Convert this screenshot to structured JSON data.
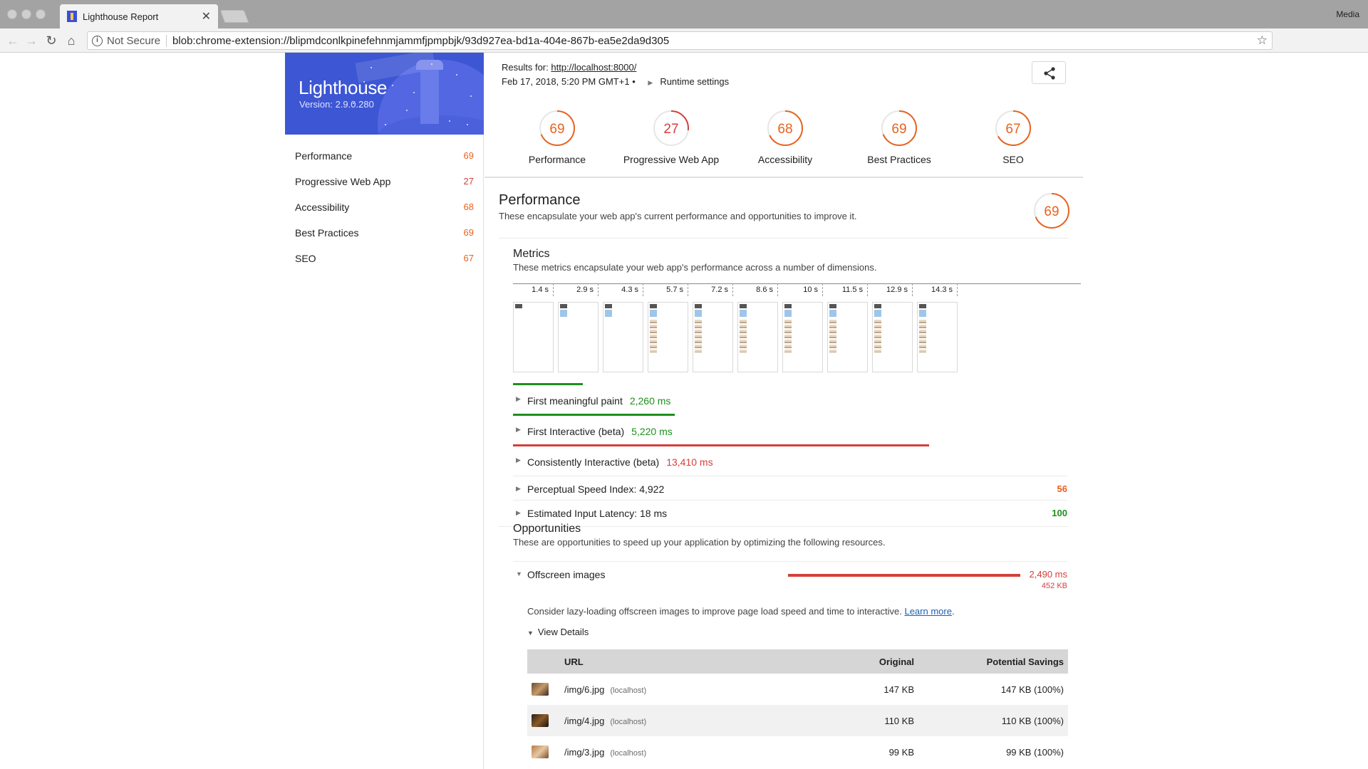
{
  "browser": {
    "tab_title": "Lighthouse Report",
    "tab_close": "✕",
    "profile": "Media",
    "security": "Not Secure",
    "url": "blob:chrome-extension://blipmdconlkpinefehnmjammfjpmpbjk/93d927ea-bd1a-404e-867b-ea5e2da9d305"
  },
  "banner": {
    "title": "Lighthouse",
    "version": "Version: 2.9.0.280"
  },
  "nav": [
    {
      "label": "Performance",
      "score": "69"
    },
    {
      "label": "Progressive Web App",
      "score": "27"
    },
    {
      "label": "Accessibility",
      "score": "68"
    },
    {
      "label": "Best Practices",
      "score": "69"
    },
    {
      "label": "SEO",
      "score": "67"
    }
  ],
  "header": {
    "results_for": "Results for:",
    "results_url": "http://localhost:8000/",
    "date": "Feb 17, 2018, 5:20 PM GMT+1",
    "bullet": "•",
    "runtime": "Runtime settings"
  },
  "gauges": [
    {
      "label": "Performance",
      "score": 69,
      "color": "#e8621f"
    },
    {
      "label": "Progressive Web App",
      "score": 27,
      "color": "#d43f3a"
    },
    {
      "label": "Accessibility",
      "score": 68,
      "color": "#e8621f"
    },
    {
      "label": "Best Practices",
      "score": 69,
      "color": "#e8621f"
    },
    {
      "label": "SEO",
      "score": 67,
      "color": "#e8621f"
    }
  ],
  "performance": {
    "title": "Performance",
    "description": "These encapsulate your web app's current performance and opportunities to improve it.",
    "score": 69
  },
  "metrics": {
    "title": "Metrics",
    "description": "These metrics encapsulate your web app's performance across a number of dimensions.",
    "filmstrip_times": [
      "1.4 s",
      "2.9 s",
      "4.3 s",
      "5.7 s",
      "7.2 s",
      "8.6 s",
      "10 s",
      "11.5 s",
      "12.9 s",
      "14.3 s"
    ],
    "timeline": [
      {
        "label": "First meaningful paint",
        "value": "2,260 ms",
        "ms": 2260,
        "status": "green"
      },
      {
        "label": "First Interactive (beta)",
        "value": "5,220 ms",
        "ms": 5220,
        "status": "green"
      },
      {
        "label": "Consistently Interactive (beta)",
        "value": "13,410 ms",
        "ms": 13410,
        "status": "red"
      }
    ],
    "scored": [
      {
        "label": "Perceptual Speed Index: 4,922",
        "score": "56",
        "status": "orange"
      },
      {
        "label": "Estimated Input Latency: 18 ms",
        "score": "100",
        "status": "green"
      }
    ]
  },
  "opportunities": {
    "title": "Opportunities",
    "description": "These are opportunities to speed up your application by optimizing the following resources.",
    "item": {
      "label": "Offscreen images",
      "ms": "2,490 ms",
      "kb": "452 KB",
      "help": "Consider lazy-loading offscreen images to improve page load speed and time to interactive.",
      "learn_more": "Learn more",
      "details": "View Details"
    },
    "table": {
      "headers": {
        "url": "URL",
        "original": "Original",
        "savings": "Potential Savings"
      },
      "rows": [
        {
          "url": "/img/6.jpg",
          "host": "(localhost)",
          "original": "147 KB",
          "savings": "147 KB (100%)"
        },
        {
          "url": "/img/4.jpg",
          "host": "(localhost)",
          "original": "110 KB",
          "savings": "110 KB (100%)"
        },
        {
          "url": "/img/3.jpg",
          "host": "(localhost)",
          "original": "99 KB",
          "savings": "99 KB (100%)"
        }
      ]
    }
  }
}
